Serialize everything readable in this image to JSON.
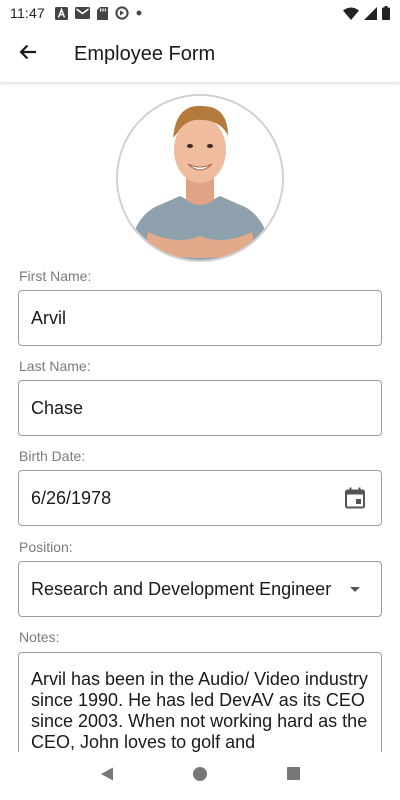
{
  "status_bar": {
    "time": "11:47",
    "icons": [
      "a-icon",
      "gmail-icon",
      "sd-card-icon",
      "sync-icon",
      "dot-icon",
      "wifi-icon",
      "signal-icon",
      "battery-icon"
    ]
  },
  "app_bar": {
    "title": "Employee Form",
    "back_icon": "arrow-back-icon"
  },
  "form": {
    "first_name": {
      "label": "First Name:",
      "value": "Arvil"
    },
    "last_name": {
      "label": "Last Name:",
      "value": "Chase"
    },
    "birth_date": {
      "label": "Birth Date:",
      "value": "6/26/1978",
      "icon": "calendar-icon"
    },
    "position": {
      "label": "Position:",
      "value": "Research and Development Engineer",
      "icon": "dropdown-arrow-icon"
    },
    "notes": {
      "label": "Notes:",
      "value": "Arvil has been in the Audio/ Video industry since 1990. He has led DevAV as its CEO since 2003. When not working hard as the CEO, John loves to golf and"
    }
  },
  "nav_bar": {
    "icons": [
      "back-triangle-icon",
      "home-circle-icon",
      "recents-square-icon"
    ]
  },
  "colors": {
    "border": "#9e9e9e",
    "label": "#7a7a7a",
    "text": "#1a1a1a"
  }
}
